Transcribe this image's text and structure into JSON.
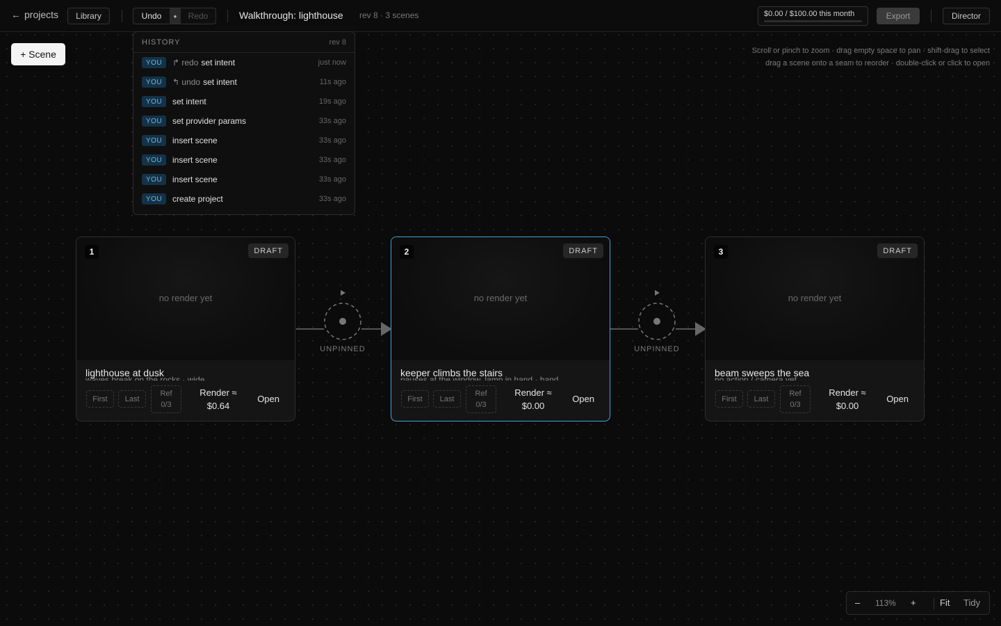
{
  "header": {
    "back_label": "projects",
    "library_label": "Library",
    "undo_label": "Undo",
    "redo_label": "Redo",
    "title": "Walkthrough: lighthouse",
    "subtitle": "rev 8 · 3 scenes",
    "budget_text": "$0.00 / $100.00 this month",
    "budget_fraction": 0.0,
    "export_label": "Export",
    "director_label": "Director"
  },
  "canvas": {
    "add_scene_label": "+ Scene",
    "hint_line1": "Scroll or pinch to zoom · drag empty space to pan · shift-drag to select",
    "hint_line2": "drag a scene onto a seam to reorder · double-click or click to open"
  },
  "history": {
    "heading": "HISTORY",
    "rev": "rev 8",
    "items": [
      {
        "who": "YOU",
        "prefix": "↱ redo",
        "action": "set intent",
        "time": "just now"
      },
      {
        "who": "YOU",
        "prefix": "↰ undo",
        "action": "set intent",
        "time": "11s ago"
      },
      {
        "who": "YOU",
        "prefix": "",
        "action": "set intent",
        "time": "19s ago"
      },
      {
        "who": "YOU",
        "prefix": "",
        "action": "set provider params",
        "time": "33s ago"
      },
      {
        "who": "YOU",
        "prefix": "",
        "action": "insert scene",
        "time": "33s ago"
      },
      {
        "who": "YOU",
        "prefix": "",
        "action": "insert scene",
        "time": "33s ago"
      },
      {
        "who": "YOU",
        "prefix": "",
        "action": "insert scene",
        "time": "33s ago"
      },
      {
        "who": "YOU",
        "prefix": "",
        "action": "create project",
        "time": "33s ago"
      }
    ]
  },
  "scenes": [
    {
      "number": "1",
      "status": "DRAFT",
      "placeholder": "no render yet",
      "title": "lighthouse at dusk",
      "subtitle": "waves break on the rocks · wide",
      "first": "First",
      "last": "Last",
      "ref_label": "Ref",
      "ref_count": "0/3",
      "render_label": "Render ≈",
      "render_cost": "$0.64",
      "open_label": "Open",
      "selected": false
    },
    {
      "number": "2",
      "status": "DRAFT",
      "placeholder": "no render yet",
      "title": "keeper climbs the stairs",
      "subtitle": "pauses at the window, lamp in hand · hand",
      "first": "First",
      "last": "Last",
      "ref_label": "Ref",
      "ref_count": "0/3",
      "render_label": "Render ≈",
      "render_cost": "$0.00",
      "open_label": "Open",
      "selected": true
    },
    {
      "number": "3",
      "status": "DRAFT",
      "placeholder": "no render yet",
      "title": "beam sweeps the sea",
      "subtitle": "no action / camera yet",
      "first": "First",
      "last": "Last",
      "ref_label": "Ref",
      "ref_count": "0/3",
      "render_label": "Render ≈",
      "render_cost": "$0.00",
      "open_label": "Open",
      "selected": false
    }
  ],
  "seams": [
    {
      "label": "UNPINNED"
    },
    {
      "label": "UNPINNED"
    }
  ],
  "zoom": {
    "minus": "–",
    "level": "113%",
    "plus": "+",
    "fit_label": "Fit",
    "tidy_label": "Tidy"
  },
  "colors": {
    "selected_border": "#4aa3cf",
    "you_badge_bg": "#143247",
    "you_badge_text": "#6fb6e0"
  }
}
